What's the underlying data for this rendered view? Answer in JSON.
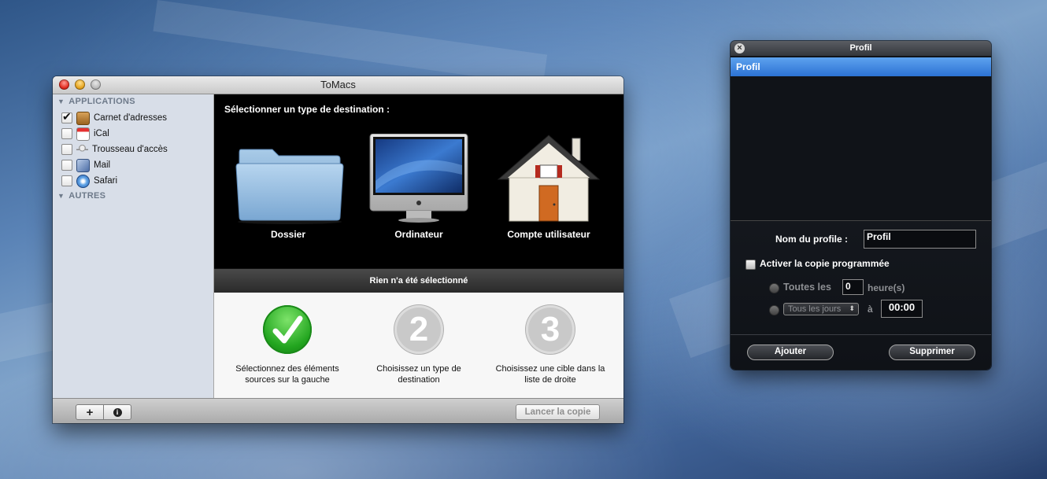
{
  "main_window": {
    "title": "ToMacs",
    "sidebar": {
      "groups": [
        {
          "label": "APPLICATIONS",
          "items": [
            {
              "label": "Carnet d'adresses",
              "checked": true,
              "icon": "address-book-icon"
            },
            {
              "label": "iCal",
              "checked": false,
              "icon": "calendar-icon"
            },
            {
              "label": "Trousseau d'accès",
              "checked": false,
              "icon": "keychain-icon"
            },
            {
              "label": "Mail",
              "checked": false,
              "icon": "mail-icon"
            },
            {
              "label": "Safari",
              "checked": false,
              "icon": "safari-icon"
            }
          ]
        },
        {
          "label": "AUTRES",
          "items": []
        }
      ]
    },
    "destination": {
      "prompt": "Sélectionner un type de destination :",
      "options": [
        {
          "label": "Dossier",
          "icon": "folder-icon"
        },
        {
          "label": "Ordinateur",
          "icon": "imac-icon"
        },
        {
          "label": "Compte utilisateur",
          "icon": "house-icon"
        }
      ]
    },
    "status": "Rien n'a été sélectionné",
    "steps": [
      {
        "number": "",
        "description": "Sélectionnez des éléments sources sur la gauche",
        "done": true
      },
      {
        "number": "2",
        "description": "Choisissez un type de destination",
        "done": false
      },
      {
        "number": "3",
        "description": "Choisissez une cible dans la liste de droite",
        "done": false
      }
    ],
    "bottom_bar": {
      "add_symbol": "+",
      "info_symbol": "i",
      "launch_label": "Lancer la copie"
    }
  },
  "profile_panel": {
    "title": "Profil",
    "profiles": [
      "Profil"
    ],
    "selected_profile": "Profil",
    "name_label": "Nom du profile :",
    "name_value": "Profil",
    "schedule_label": "Activer la copie programmée",
    "every_label": "Toutes les",
    "every_value": "0",
    "hours_label": "heure(s)",
    "frequency_option": "Tous les jours",
    "at_label": "à",
    "time_value": "00:00",
    "add_label": "Ajouter",
    "delete_label": "Supprimer"
  },
  "colors": {
    "selection_blue": "#3a80dc",
    "checkmark_green": "#2db82d",
    "step_gray": "#c4c4c4"
  }
}
